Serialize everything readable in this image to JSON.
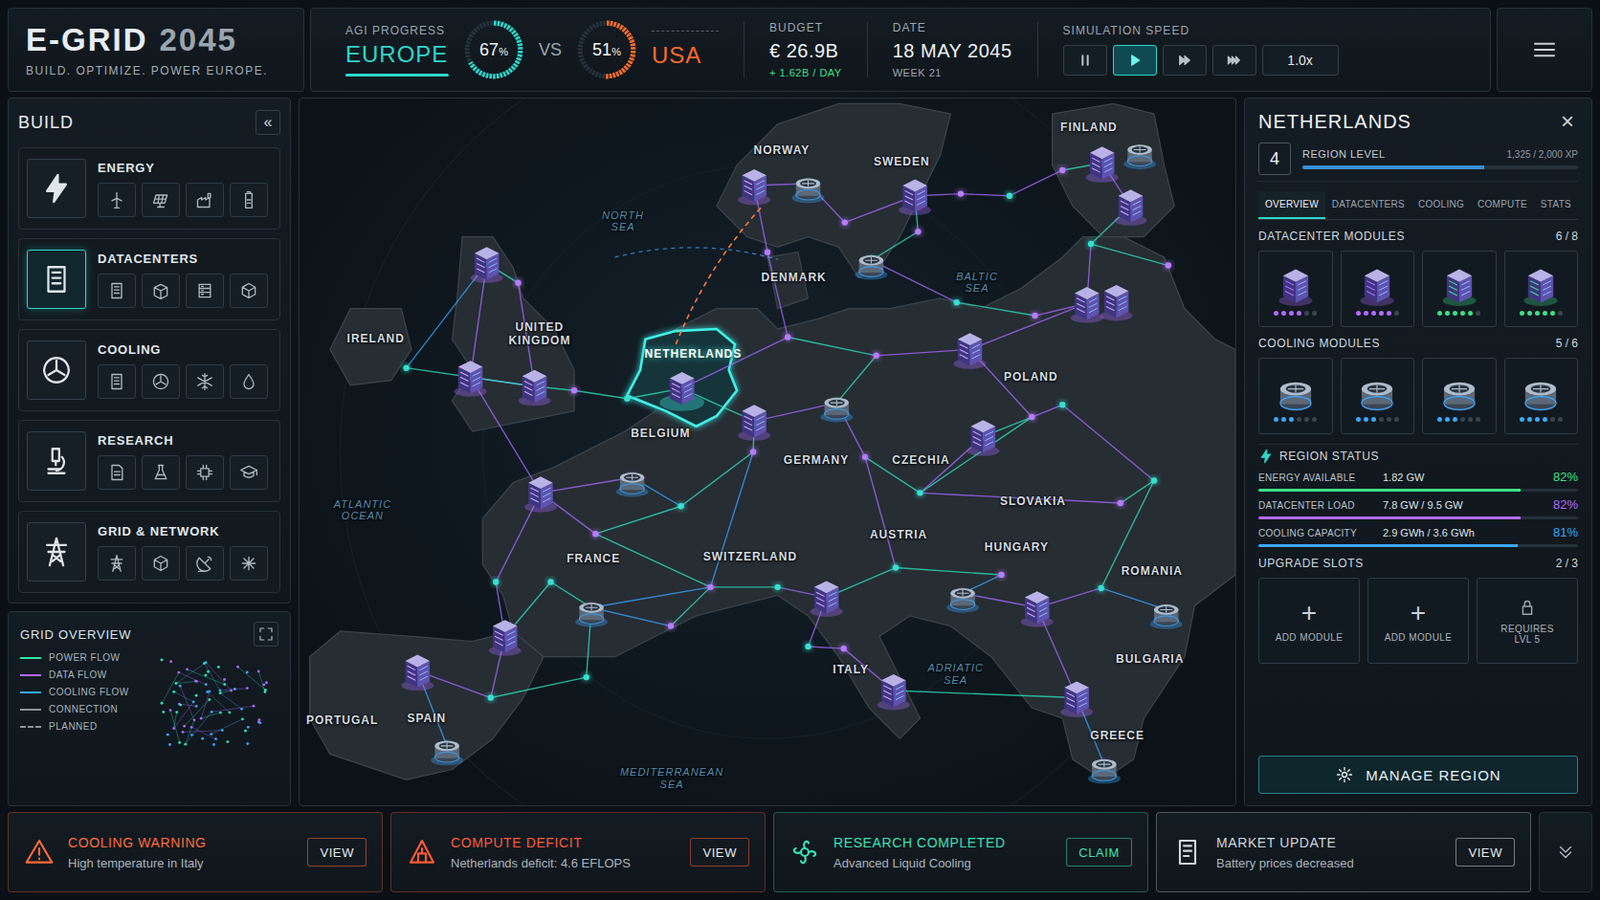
{
  "header": {
    "logo": {
      "main": "E-GRID",
      "year": "2045",
      "tagline": "BUILD. OPTIMIZE. POWER EUROPE."
    },
    "agi": {
      "label": "AGI PROGRESS",
      "vs": "VS",
      "left": {
        "name": "EUROPE",
        "value": "67",
        "unit": "%",
        "level": 0.67,
        "color": "#2fd6c9"
      },
      "right": {
        "name": "USA",
        "value": "51",
        "unit": "%",
        "level": 0.51,
        "color": "#ff6a2b"
      }
    },
    "budget": {
      "label": "BUDGET",
      "value": "€ 26.9B",
      "delta": "+ 1.62B / DAY"
    },
    "date": {
      "label": "DATE",
      "value": "18 MAY 2045",
      "week": "WEEK 21"
    },
    "speed": {
      "label": "SIMULATION SPEED",
      "controls": [
        {
          "kind": "pause",
          "selected": false
        },
        {
          "kind": "play",
          "selected": true
        },
        {
          "kind": "fast",
          "selected": false
        },
        {
          "kind": "faster",
          "selected": false
        }
      ],
      "multiplier": "1.0x"
    }
  },
  "build": {
    "title": "BUILD",
    "collapse": "«",
    "categories": [
      {
        "name": "ENERGY",
        "selected": false
      },
      {
        "name": "DATACENTERS",
        "selected": true
      },
      {
        "name": "COOLING",
        "selected": false
      },
      {
        "name": "RESEARCH",
        "selected": false
      },
      {
        "name": "GRID & NETWORK",
        "selected": false
      }
    ]
  },
  "grid_overview": {
    "title": "GRID OVERVIEW",
    "legend": [
      {
        "label": "POWER FLOW",
        "color": "#2ee6a6",
        "kind": "solid"
      },
      {
        "label": "DATA FLOW",
        "color": "#b06bff",
        "kind": "solid"
      },
      {
        "label": "COOLING FLOW",
        "color": "#3aa8ff",
        "kind": "solid"
      },
      {
        "label": "CONNECTION",
        "color": "#8a949c",
        "kind": "solid"
      },
      {
        "label": "PLANNED",
        "color": "#8a949c",
        "kind": "dashed"
      }
    ]
  },
  "map": {
    "labels": [
      {
        "text": "NORWAY",
        "kind": "country",
        "selected": false
      },
      {
        "text": "SWEDEN",
        "kind": "country",
        "selected": false
      },
      {
        "text": "FINLAND",
        "kind": "country",
        "selected": false
      },
      {
        "text": "NORTH SEA",
        "kind": "sea",
        "selected": false
      },
      {
        "text": "DENMARK",
        "kind": "country",
        "selected": false
      },
      {
        "text": "BALTIC SEA",
        "kind": "sea",
        "selected": false
      },
      {
        "text": "IRELAND",
        "kind": "country",
        "selected": false
      },
      {
        "text": "UNITED KINGDOM",
        "kind": "country",
        "selected": false
      },
      {
        "text": "NETHERLANDS",
        "kind": "country",
        "selected": true
      },
      {
        "text": "POLAND",
        "kind": "country",
        "selected": false
      },
      {
        "text": "BELGIUM",
        "kind": "country",
        "selected": false
      },
      {
        "text": "GERMANY",
        "kind": "country",
        "selected": false
      },
      {
        "text": "CZECHIA",
        "kind": "country",
        "selected": false
      },
      {
        "text": "SLOVAKIA",
        "kind": "country",
        "selected": false
      },
      {
        "text": "ATLANTIC OCEAN",
        "kind": "sea",
        "selected": false
      },
      {
        "text": "AUSTRIA",
        "kind": "country",
        "selected": false
      },
      {
        "text": "HUNGARY",
        "kind": "country",
        "selected": false
      },
      {
        "text": "FRANCE",
        "kind": "country",
        "selected": false
      },
      {
        "text": "SWITZERLAND",
        "kind": "country",
        "selected": false
      },
      {
        "text": "ROMANIA",
        "kind": "country",
        "selected": false
      },
      {
        "text": "BULGARIA",
        "kind": "country",
        "selected": false
      },
      {
        "text": "ITALY",
        "kind": "country",
        "selected": false
      },
      {
        "text": "ADRIATIC SEA",
        "kind": "sea",
        "selected": false
      },
      {
        "text": "PORTUGAL",
        "kind": "country",
        "selected": false
      },
      {
        "text": "SPAIN",
        "kind": "country",
        "selected": false
      },
      {
        "text": "GREECE",
        "kind": "country",
        "selected": false
      },
      {
        "text": "MEDITERRANEAN SEA",
        "kind": "sea",
        "selected": false
      }
    ],
    "pins": [
      {
        "kind": "datacenter",
        "selected": false
      },
      {
        "kind": "cooling",
        "selected": false
      },
      {
        "kind": "datacenter",
        "selected": false
      },
      {
        "kind": "cooling",
        "selected": false
      },
      {
        "kind": "datacenter",
        "selected": false
      },
      {
        "kind": "cooling",
        "selected": false
      },
      {
        "kind": "datacenter",
        "selected": false
      },
      {
        "kind": "datacenter",
        "selected": false
      },
      {
        "kind": "datacenter",
        "selected": false
      },
      {
        "kind": "datacenter",
        "selected": false
      },
      {
        "kind": "datacenter",
        "selected": false
      },
      {
        "kind": "datacenter",
        "selected": false
      },
      {
        "kind": "datacenter",
        "selected": true
      },
      {
        "kind": "datacenter",
        "selected": false
      },
      {
        "kind": "cooling",
        "selected": false
      },
      {
        "kind": "datacenter",
        "selected": false
      },
      {
        "kind": "datacenter",
        "selected": false
      },
      {
        "kind": "datacenter",
        "selected": false
      },
      {
        "kind": "cooling",
        "selected": false
      },
      {
        "kind": "datacenter",
        "selected": false
      },
      {
        "kind": "cooling",
        "selected": false
      },
      {
        "kind": "datacenter",
        "selected": false
      },
      {
        "kind": "cooling",
        "selected": false
      },
      {
        "kind": "datacenter",
        "selected": false
      },
      {
        "kind": "datacenter",
        "selected": false
      },
      {
        "kind": "cooling",
        "selected": false
      },
      {
        "kind": "datacenter",
        "selected": false
      },
      {
        "kind": "cooling",
        "selected": false
      },
      {
        "kind": "datacenter",
        "selected": false
      },
      {
        "kind": "cooling",
        "selected": false
      }
    ]
  },
  "region": {
    "title": "NETHERLANDS",
    "close": "×",
    "level": "4",
    "level_label": "REGION LEVEL",
    "xp": "1,325 / 2,000 XP",
    "xp_level": 0.66,
    "tabs": [
      {
        "label": "OVERVIEW",
        "selected": true
      },
      {
        "label": "DATACENTERS",
        "selected": false
      },
      {
        "label": "COOLING",
        "selected": false
      },
      {
        "label": "COMPUTE",
        "selected": false
      },
      {
        "label": "STATS",
        "selected": false
      }
    ],
    "datacenter_modules": {
      "title": "DATACENTER MODULES",
      "count": "6 / 8",
      "items": [
        {
          "stars": 4,
          "color": "#b06bff"
        },
        {
          "stars": 5,
          "color": "#b06bff"
        },
        {
          "stars": 5,
          "color": "#3ee08a"
        },
        {
          "stars": 5,
          "color": "#3ee08a"
        }
      ]
    },
    "cooling_modules": {
      "title": "COOLING MODULES",
      "count": "5 / 6",
      "items": [
        {
          "stars": 3,
          "color": "#3aa8ff"
        },
        {
          "stars": 3,
          "color": "#3aa8ff"
        },
        {
          "stars": 3,
          "color": "#3aa8ff"
        },
        {
          "stars": 4,
          "color": "#3aa8ff"
        }
      ]
    },
    "status": {
      "title": "REGION STATUS",
      "rows": [
        {
          "label": "ENERGY AVAILABLE",
          "value": "1.82 GW",
          "percent": "82%",
          "level": 0.82,
          "color": "#3ee08a"
        },
        {
          "label": "DATACENTER LOAD",
          "value": "7.8 GW / 9.5 GW",
          "percent": "82%",
          "level": 0.82,
          "color": "#b06bff"
        },
        {
          "label": "COOLING CAPACITY",
          "value": "2.9 GWh / 3.6 GWh",
          "percent": "81%",
          "level": 0.81,
          "color": "#3aa8ff"
        }
      ]
    },
    "upgrades": {
      "title": "UPGRADE SLOTS",
      "count": "2 / 3",
      "slots": [
        {
          "kind": "add",
          "icon": "+",
          "label": "ADD MODULE"
        },
        {
          "kind": "add",
          "icon": "+",
          "label": "ADD MODULE"
        },
        {
          "kind": "locked",
          "icon": "",
          "label": "REQUIRES LVL 5"
        }
      ]
    },
    "manage": "MANAGE REGION"
  },
  "notifications": [
    {
      "kind": "warning",
      "title": "COOLING WARNING",
      "text": "High temperature in Italy",
      "action": "VIEW",
      "color": "#ff6b3d"
    },
    {
      "kind": "deficit",
      "title": "COMPUTE DEFICIT",
      "text": "Netherlands deficit: 4.6 EFLOPS",
      "action": "VIEW",
      "color": "#ff5a3a"
    },
    {
      "kind": "research",
      "title": "RESEARCH COMPLETED",
      "text": "Advanced Liquid Cooling",
      "action": "CLAIM",
      "color": "#3ee0b5"
    },
    {
      "kind": "market",
      "title": "MARKET UPDATE",
      "text": "Battery prices decreased",
      "action": "VIEW",
      "color": "#cfd6dd"
    }
  ]
}
